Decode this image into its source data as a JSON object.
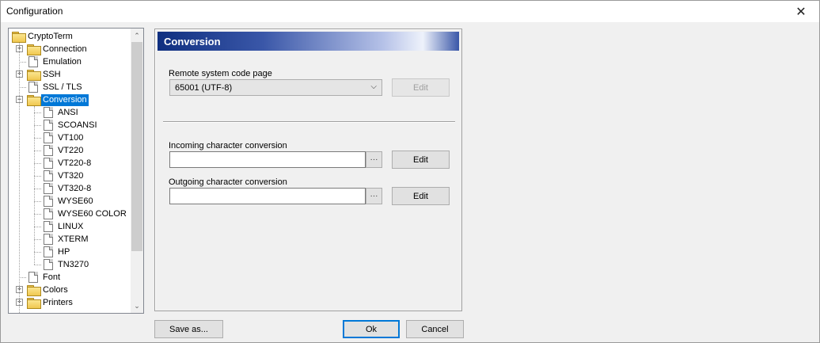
{
  "window": {
    "title": "Configuration"
  },
  "tree": {
    "items": [
      {
        "label": "CryptoTerm",
        "kind": "folder",
        "level": 0,
        "expander": ""
      },
      {
        "label": "Connection",
        "kind": "folder",
        "level": 1,
        "expander": "+"
      },
      {
        "label": "Emulation",
        "kind": "doc",
        "level": 1,
        "expander": ""
      },
      {
        "label": "SSH",
        "kind": "folder",
        "level": 1,
        "expander": "+"
      },
      {
        "label": "SSL / TLS",
        "kind": "doc",
        "level": 1,
        "expander": ""
      },
      {
        "label": "Conversion",
        "kind": "folder",
        "level": 1,
        "expander": "-",
        "selected": true
      },
      {
        "label": "ANSI",
        "kind": "doc",
        "level": 2,
        "expander": ""
      },
      {
        "label": "SCOANSI",
        "kind": "doc",
        "level": 2,
        "expander": ""
      },
      {
        "label": "VT100",
        "kind": "doc",
        "level": 2,
        "expander": ""
      },
      {
        "label": "VT220",
        "kind": "doc",
        "level": 2,
        "expander": ""
      },
      {
        "label": "VT220-8",
        "kind": "doc",
        "level": 2,
        "expander": ""
      },
      {
        "label": "VT320",
        "kind": "doc",
        "level": 2,
        "expander": ""
      },
      {
        "label": "VT320-8",
        "kind": "doc",
        "level": 2,
        "expander": ""
      },
      {
        "label": "WYSE60",
        "kind": "doc",
        "level": 2,
        "expander": ""
      },
      {
        "label": "WYSE60 COLOR",
        "kind": "doc",
        "level": 2,
        "expander": ""
      },
      {
        "label": "LINUX",
        "kind": "doc",
        "level": 2,
        "expander": ""
      },
      {
        "label": "XTERM",
        "kind": "doc",
        "level": 2,
        "expander": ""
      },
      {
        "label": "HP",
        "kind": "doc",
        "level": 2,
        "expander": ""
      },
      {
        "label": "TN3270",
        "kind": "doc",
        "level": 2,
        "expander": ""
      },
      {
        "label": "Font",
        "kind": "doc",
        "level": 1,
        "expander": ""
      },
      {
        "label": "Colors",
        "kind": "folder",
        "level": 1,
        "expander": "+"
      },
      {
        "label": "Printers",
        "kind": "folder",
        "level": 1,
        "expander": "+"
      }
    ]
  },
  "panel": {
    "header": "Conversion",
    "code_page_label": "Remote system code page",
    "code_page_value": "65001 (UTF-8)",
    "code_page_edit": "Edit",
    "incoming_label": "Incoming character conversion",
    "incoming_value": "",
    "incoming_browse": "···",
    "incoming_edit": "Edit",
    "outgoing_label": "Outgoing character conversion",
    "outgoing_value": "",
    "outgoing_browse": "···",
    "outgoing_edit": "Edit"
  },
  "footer": {
    "save_as": "Save as...",
    "ok": "Ok",
    "cancel": "Cancel"
  },
  "colors": {
    "selection": "#0078d7",
    "header_dark": "#0f2f80"
  }
}
